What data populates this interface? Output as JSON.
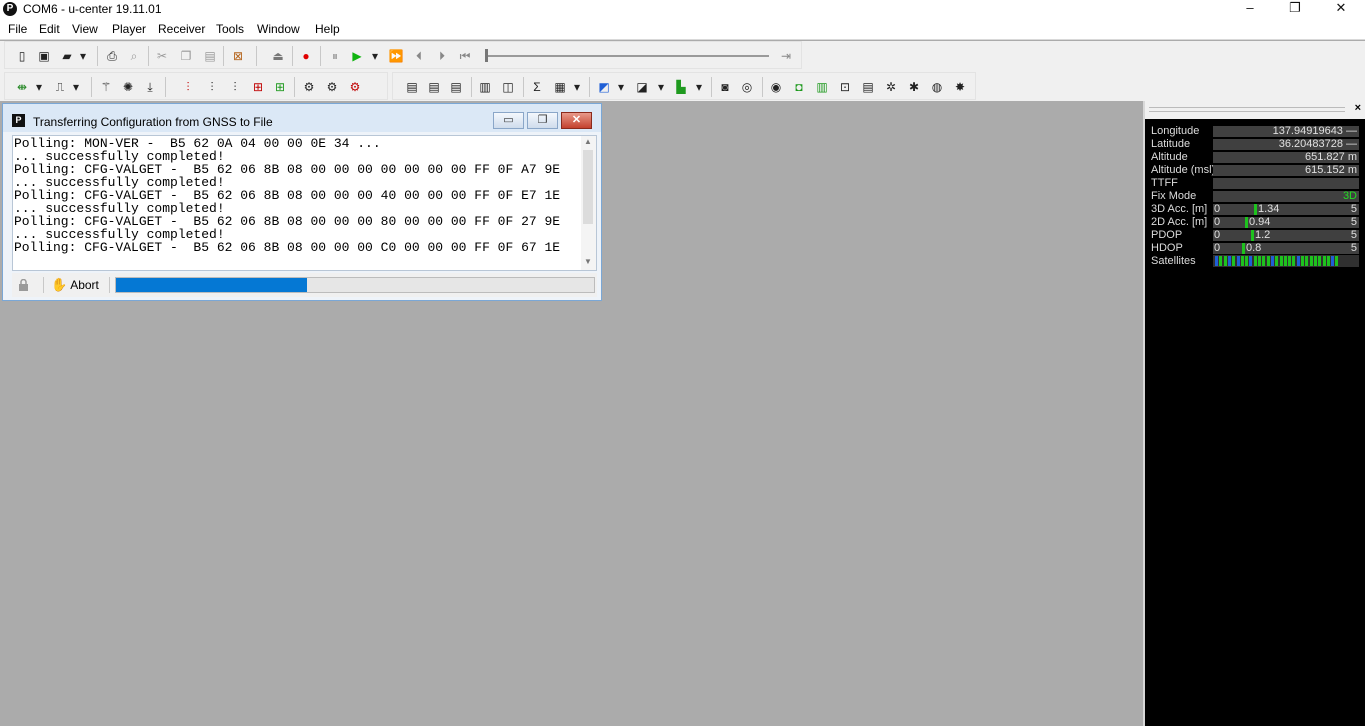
{
  "window": {
    "title": "COM6 - u-center 19.11.01",
    "icon_letter": "P",
    "minimize": "–",
    "maximize": "❐",
    "close": "✕"
  },
  "menu": [
    "File",
    "Edit",
    "View",
    "Player",
    "Receiver",
    "Tools",
    "Window",
    "Help"
  ],
  "dialog": {
    "title": "Transferring Configuration from GNSS to File",
    "icon_letter": "P",
    "log": [
      "Polling: MON-VER -  B5 62 0A 04 00 00 0E 34 ...",
      "... successfully completed!",
      "Polling: CFG-VALGET -  B5 62 06 8B 08 00 00 00 00 00 00 00 FF 0F A7 9E",
      "... successfully completed!",
      "Polling: CFG-VALGET -  B5 62 06 8B 08 00 00 00 40 00 00 00 FF 0F E7 1E",
      "... successfully completed!",
      "Polling: CFG-VALGET -  B5 62 06 8B 08 00 00 00 80 00 00 00 FF 0F 27 9E",
      "... successfully completed!",
      "Polling: CFG-VALGET -  B5 62 06 8B 08 00 00 00 C0 00 00 00 FF 0F 67 1E"
    ],
    "abort_label": "Abort",
    "progress_fraction": 0.4
  },
  "info_panel": {
    "close": "×",
    "longitude": {
      "label": "Longitude",
      "value": "137.94919643 —"
    },
    "latitude": {
      "label": "Latitude",
      "value": "36.20483728 —"
    },
    "altitude": {
      "label": "Altitude",
      "value": "651.827 m"
    },
    "altitude_msl": {
      "label": "Altitude (msl)",
      "value": "615.152 m"
    },
    "ttff": {
      "label": "TTFF",
      "value": ""
    },
    "fix_mode": {
      "label": "Fix Mode",
      "value": "3D",
      "color": "#22dd22"
    },
    "acc3d": {
      "label": "3D Acc. [m]",
      "min": "0",
      "max": "5",
      "value": "1.34",
      "level": 0.268
    },
    "acc2d": {
      "label": "2D Acc. [m]",
      "min": "0",
      "max": "5",
      "value": "0.94",
      "level": 0.188
    },
    "pdop": {
      "label": "PDOP",
      "min": "0",
      "max": "5",
      "value": "1.2",
      "level": 0.24
    },
    "hdop": {
      "label": "HDOP",
      "min": "0",
      "max": "5",
      "value": "0.8",
      "level": 0.16
    },
    "satellites": {
      "label": "Satellites",
      "count_green": 22,
      "count_blue": 7
    }
  },
  "colors": {
    "accent": "#0578d4",
    "panel_bg": "#000000",
    "bar_green": "#1ec21e",
    "sat_blue": "#1f5fd6"
  }
}
